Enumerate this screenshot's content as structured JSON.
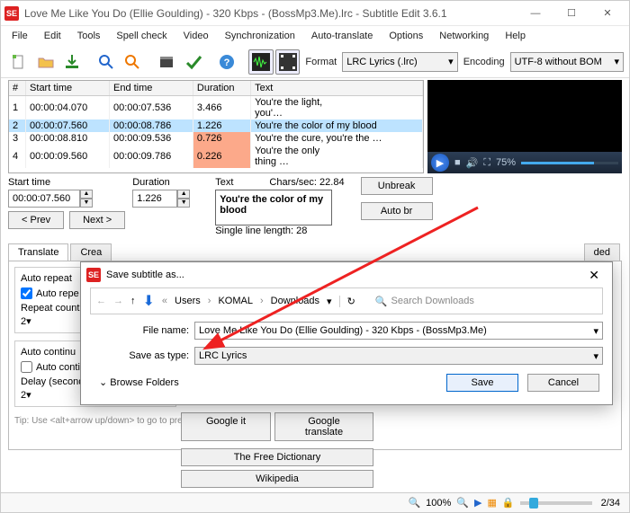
{
  "window": {
    "title": "Love Me Like You Do (Ellie Goulding) - 320 Kbps - (BossMp3.Me).lrc - Subtitle Edit 3.6.1",
    "app_icon_text": "SE"
  },
  "menubar": [
    "File",
    "Edit",
    "Tools",
    "Spell check",
    "Video",
    "Synchronization",
    "Auto-translate",
    "Options",
    "Networking",
    "Help"
  ],
  "toolbar": {
    "format_label": "Format",
    "format_value": "LRC Lyrics (.lrc)",
    "encoding_label": "Encoding",
    "encoding_value": "UTF-8 without BOM"
  },
  "grid": {
    "columns": [
      "#",
      "Start time",
      "End time",
      "Duration",
      "Text"
    ],
    "rows": [
      {
        "n": "1",
        "start": "00:00:04.070",
        "end": "00:00:07.536",
        "dur": "3.466",
        "text": "You're the light,<br />you'…"
      },
      {
        "n": "2",
        "start": "00:00:07.560",
        "end": "00:00:08.786",
        "dur": "1.226",
        "text": "You're the color of my blood",
        "selected": true
      },
      {
        "n": "3",
        "start": "00:00:08.810",
        "end": "00:00:09.536",
        "dur": "0.726",
        "text": "You're the cure, you're the …",
        "highlight": true
      },
      {
        "n": "4",
        "start": "00:00:09.560",
        "end": "00:00:09.786",
        "dur": "0.226",
        "text": "You're the only<br />thing …",
        "highlight": true
      }
    ]
  },
  "edit": {
    "start_label": "Start time",
    "start_value": "00:00:07.560",
    "duration_label": "Duration",
    "duration_value": "1.226",
    "text_label": "Text",
    "chars_label": "Chars/sec: 22.84",
    "text_value": "You're the color of my blood",
    "single_line": "Single line length: 28",
    "unbreak": "Unbreak",
    "autobr": "Auto br",
    "prev": "< Prev",
    "next": "Next >"
  },
  "tabs": {
    "translate": "Translate",
    "create": "Crea",
    "adjust": "ded"
  },
  "translate_panel": {
    "auto_repeat_title": "Auto repeat",
    "auto_repeat_check": "Auto repe",
    "repeat_count_label": "Repeat count",
    "repeat_count_value": "2",
    "auto_continue_title": "Auto continu",
    "auto_continue_check": "Auto continue on",
    "delay_label": "Delay (seconds)",
    "delay_value": "2",
    "google_it": "Google it",
    "google_translate": "Google translate",
    "free_dict": "The Free Dictionary",
    "wikipedia": "Wikipedia",
    "tip": "Tip: Use <alt+arrow up/down> to go to previous/next subtitle"
  },
  "video": {
    "progress": "75%"
  },
  "statusbar": {
    "zoom": "100%",
    "pos": "2/34"
  },
  "dialog": {
    "title": "Save subtitle as...",
    "crumbs": [
      "Users",
      "KOMAL",
      "Downloads"
    ],
    "search_placeholder": "Search Downloads",
    "filename_label": "File name:",
    "filename_value": "Love Me Like You Do (Ellie Goulding) - 320 Kbps - (BossMp3.Me)",
    "savetype_label": "Save as type:",
    "savetype_value": "LRC Lyrics",
    "browse": "Browse Folders",
    "save": "Save",
    "cancel": "Cancel"
  }
}
